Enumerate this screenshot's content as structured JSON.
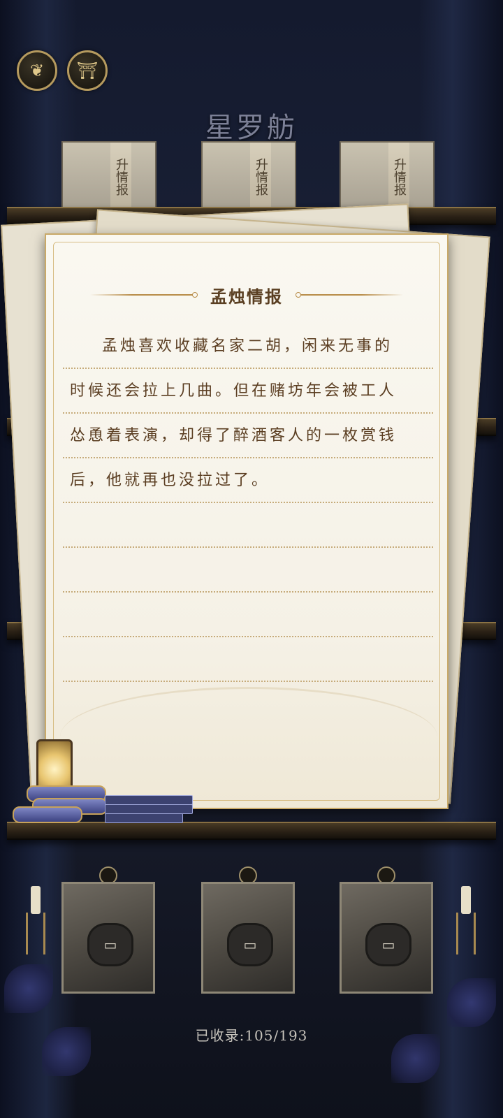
{
  "header": {
    "title": "星罗舫",
    "buttons": [
      {
        "name": "back",
        "icon": "leaf-emblem-icon"
      },
      {
        "name": "pavilion",
        "icon": "pavilion-icon"
      }
    ]
  },
  "top_cards": [
    {
      "label": "情报",
      "partial": "升"
    },
    {
      "label": "情报",
      "partial": "升"
    },
    {
      "label": "情报",
      "partial": "升"
    }
  ],
  "paper": {
    "title": "孟烛情报",
    "lines": [
      "孟烛喜欢收藏名家二胡，闲来无事的",
      "时候还会拉上几曲。但在赌坊年会被工人",
      "怂恿着表演，却得了醉酒客人的一枚赏钱",
      "后，他就再也没拉过了。",
      "",
      "",
      "",
      "",
      ""
    ]
  },
  "locked_slots": [
    {
      "icon": "lock-icon"
    },
    {
      "icon": "lock-icon"
    },
    {
      "icon": "lock-icon"
    }
  ],
  "footer": {
    "collected": "已收录:105/193"
  },
  "colors": {
    "paper": "#faf8f1",
    "gold": "#c9a968",
    "ink": "#5b3e22",
    "background": "#1b2238"
  }
}
